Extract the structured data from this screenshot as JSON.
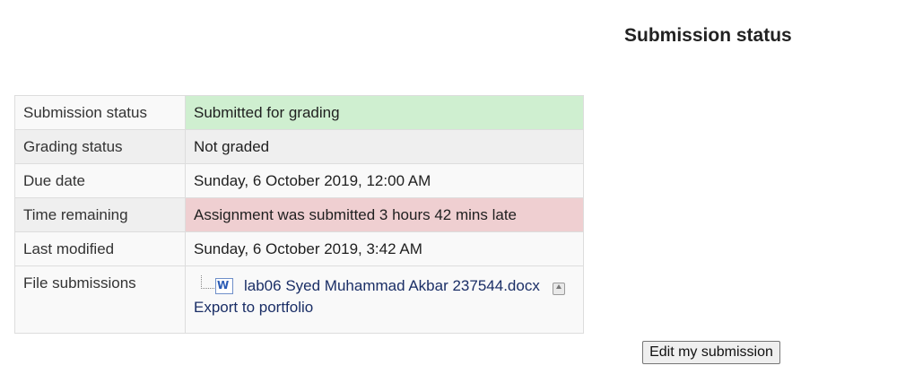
{
  "heading": "Submission status",
  "rows": [
    {
      "label": "Submission status",
      "value": "Submitted for grading"
    },
    {
      "label": "Grading status",
      "value": "Not graded"
    },
    {
      "label": "Due date",
      "value": "Sunday, 6 October 2019, 12:00 AM"
    },
    {
      "label": "Time remaining",
      "value": "Assignment was submitted 3 hours 42 mins late"
    },
    {
      "label": "Last modified",
      "value": "Sunday, 6 October 2019, 3:42 AM"
    },
    {
      "label": "File submissions"
    }
  ],
  "files": {
    "name": "lab06 Syed Muhammad Akbar 237544.docx",
    "export_label": "Export to portfolio"
  },
  "actions": {
    "edit_label": "Edit my submission"
  },
  "colors": {
    "submitted_bg": "#cfefd0",
    "late_bg": "#efcfd1"
  },
  "icons": {
    "file_type": "word-doc-icon",
    "portfolio": "export-portfolio-icon"
  }
}
